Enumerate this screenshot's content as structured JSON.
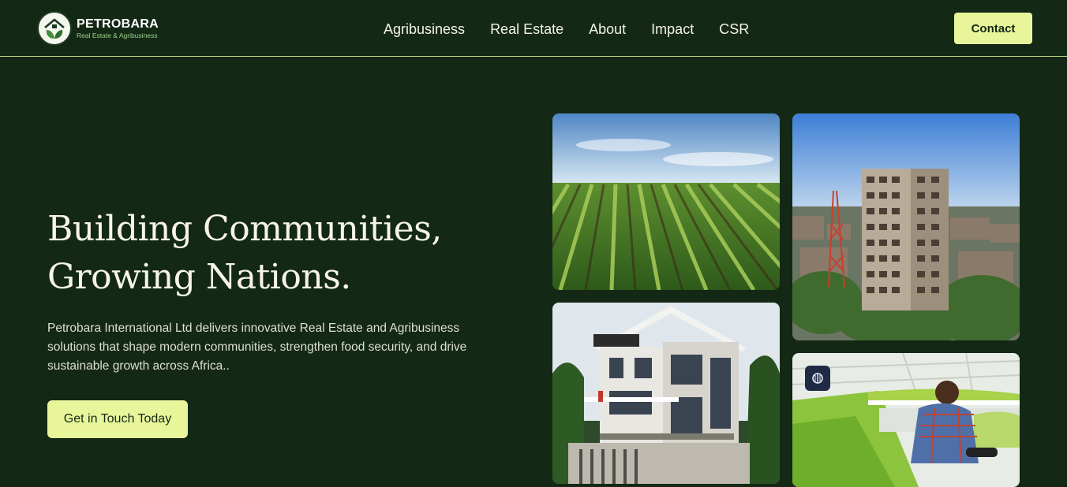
{
  "brand": {
    "name": "PETROBARA",
    "tagline": "Real Estate & Agribusiness"
  },
  "nav": {
    "items": [
      "Agribusiness",
      "Real Estate",
      "About",
      "Impact",
      "CSR"
    ]
  },
  "header": {
    "contact_label": "Contact"
  },
  "hero": {
    "title_line1": "Building Communities,",
    "title_line2": "Growing Nations.",
    "description": "Petrobara International Ltd delivers innovative Real Estate and Agribusiness solutions that shape modern communities, strengthen food security, and drive sustainable growth across Africa..",
    "cta_label": "Get in Touch Today"
  },
  "gallery": {
    "images": [
      "crop-field-photo",
      "residential-house-photo",
      "high-rise-building-photo",
      "greenhouse-farmer-photo"
    ]
  },
  "colors": {
    "background": "#132815",
    "accent": "#e8f59a",
    "divider": "#c9d98a"
  }
}
